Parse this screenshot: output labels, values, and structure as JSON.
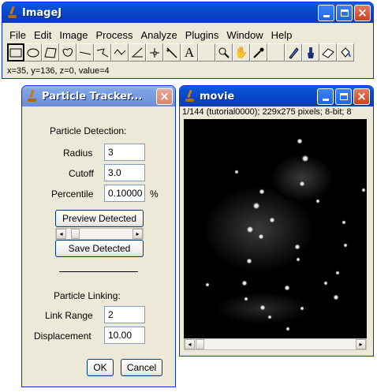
{
  "imagej": {
    "title": "ImageJ",
    "menus": [
      "File",
      "Edit",
      "Image",
      "Process",
      "Analyze",
      "Plugins",
      "Window",
      "Help"
    ],
    "tools": [
      "rectangle-tool-icon",
      "oval-tool-icon",
      "polygon-tool-icon",
      "freehand-tool-icon",
      "straight-line-tool-icon",
      "segmented-line-tool-icon",
      "freehand-line-tool-icon",
      "angle-tool-icon",
      "point-tool-icon",
      "wand-tool-icon",
      "text-tool-icon",
      "blank-slot",
      "magnifier-tool-icon",
      "hand-tool-icon",
      "dropper-tool-icon",
      "blank-slot",
      "pencil-tool-icon",
      "brush-tool-icon",
      "eraser-tool-icon",
      "flood-fill-tool-icon"
    ],
    "status": "x=35, y=136, z=0, value=4"
  },
  "tracker": {
    "title": "Particle Tracker...",
    "detection_heading": "Particle Detection:",
    "radius_label": "Radius",
    "radius_value": "3",
    "cutoff_label": "Cutoff",
    "cutoff_value": "3.0",
    "percentile_label": "Percentile",
    "percentile_value": "0.10000",
    "percentile_unit": "%",
    "preview_button": "Preview Detected",
    "save_button": "Save Detected",
    "linking_heading": "Particle Linking:",
    "link_range_label": "Link Range",
    "link_range_value": "2",
    "displacement_label": "Displacement",
    "displacement_value": "10.00",
    "ok_button": "OK",
    "cancel_button": "Cancel"
  },
  "movie": {
    "title": "movie",
    "info": "1/144 (tutorial0000); 229x275 pixels; 8-bit; 8"
  },
  "colors": {
    "titlebar_blue": "#0844c6",
    "window_bg": "#ece9d8"
  }
}
